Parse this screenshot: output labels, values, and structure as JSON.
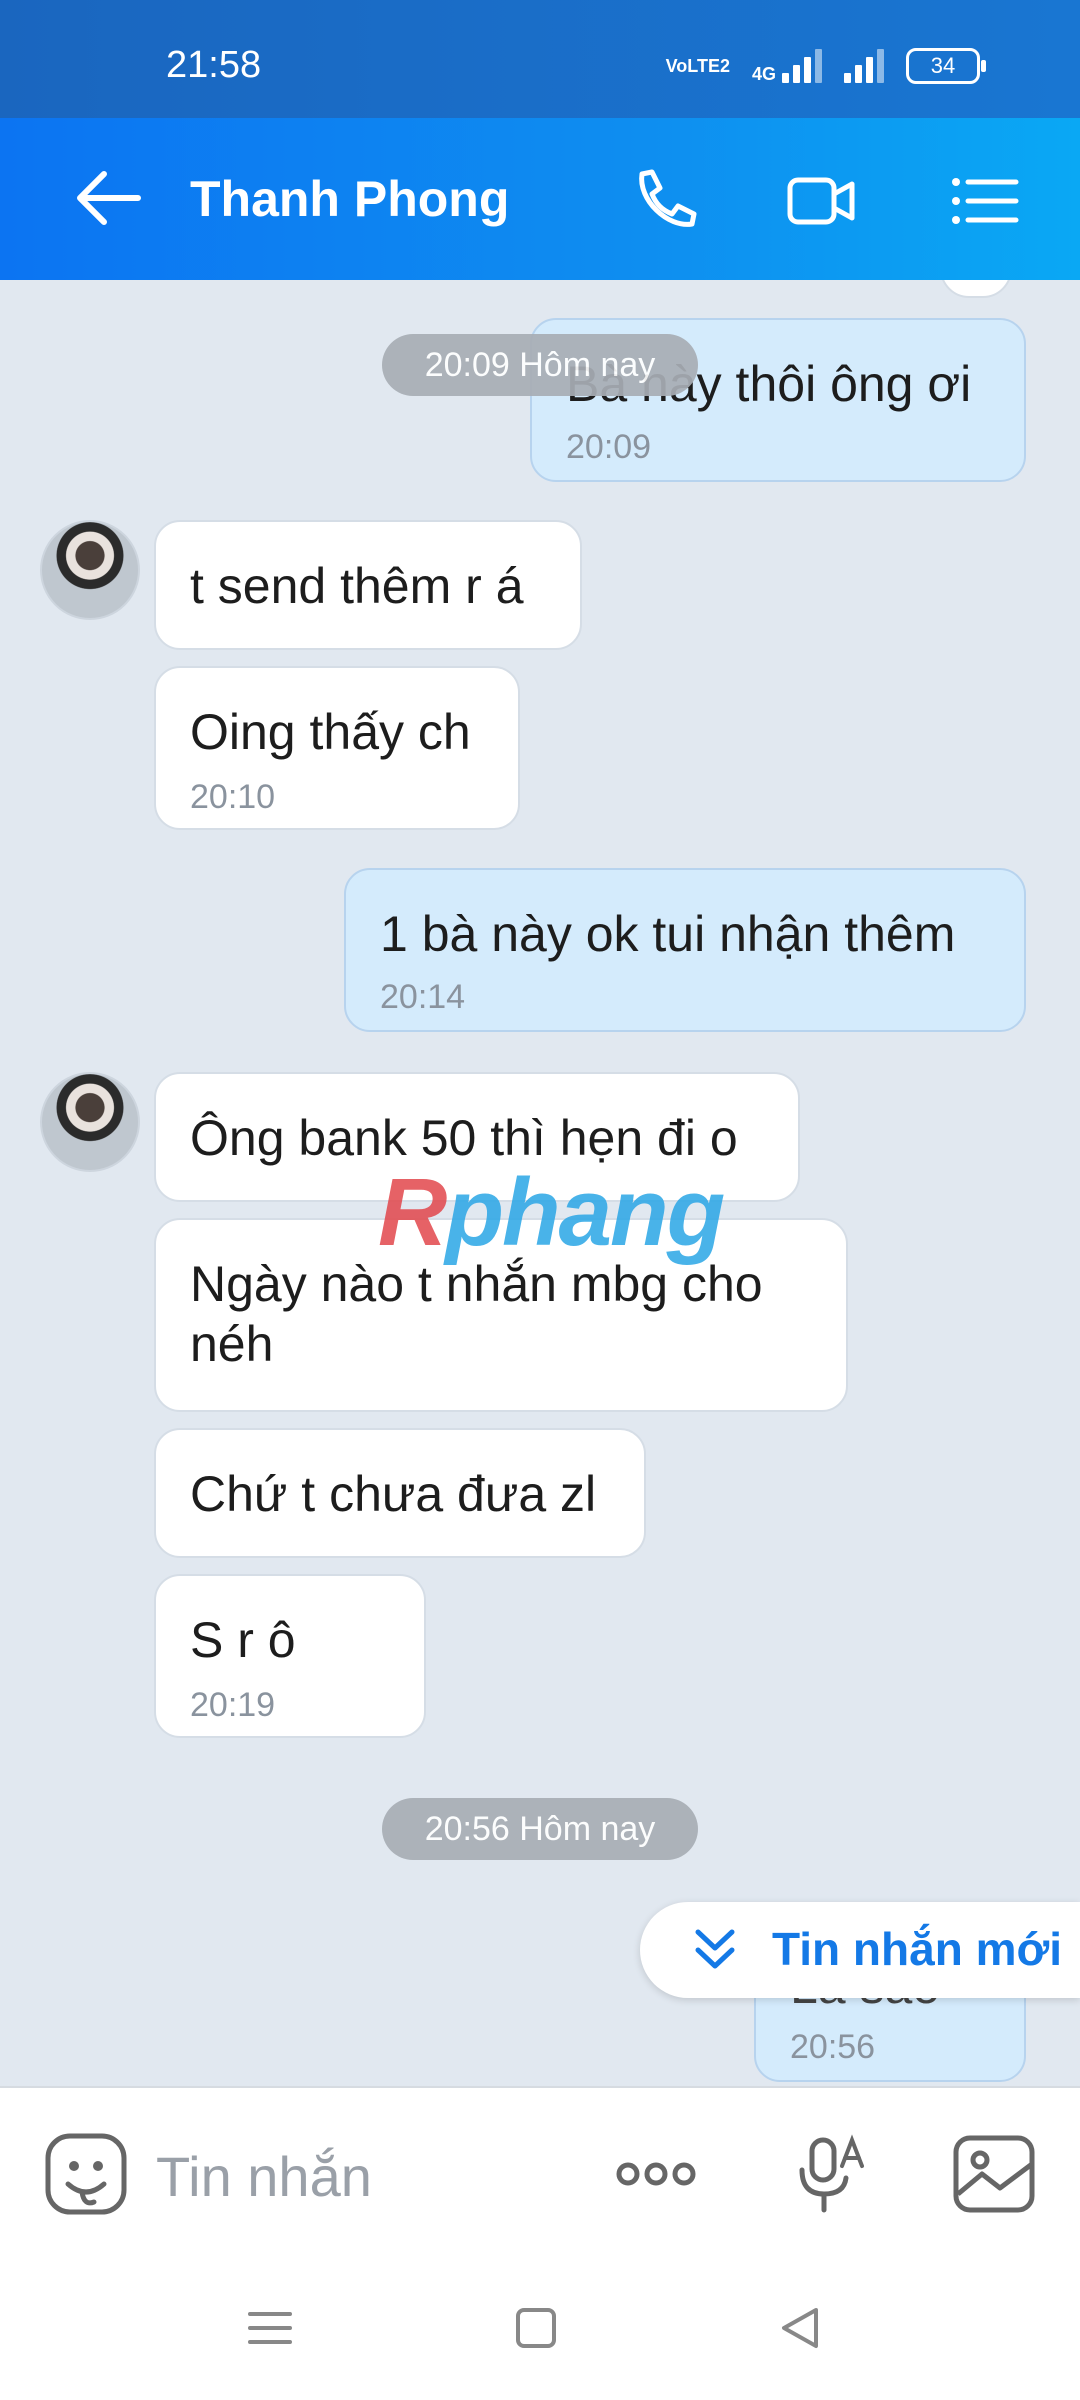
{
  "status_bar": {
    "time": "21:58",
    "network_label": "VoLTE2",
    "data_label": "4G",
    "battery": "34"
  },
  "header": {
    "contact_name": "Thanh Phong"
  },
  "messages": [
    {
      "text": "Bà này thôi ông ơi",
      "time": "20:09"
    },
    {
      "text": "t send thêm r á"
    },
    {
      "text": "Oing thấy ch",
      "time": "20:10"
    },
    {
      "text": "1 bà này ok tui nhận thêm",
      "time": "20:14"
    },
    {
      "text": "Ông bank 50 thì hẹn đi o"
    },
    {
      "text": "Ngày nào t nhắn mbg cho néh"
    },
    {
      "text": "Chứ t chưa đưa zl"
    },
    {
      "text": "S r ô",
      "time": "20:19"
    },
    {
      "text": "Là sao",
      "time": "20:56"
    }
  ],
  "date_pills": [
    "20:09 Hôm nay",
    "20:56 Hôm nay"
  ],
  "watermark": {
    "r": "R",
    "rest": "phang"
  },
  "new_messages_button": "Tin nhắn mới",
  "composer": {
    "placeholder": "Tin nhắn"
  },
  "colors": {
    "header": "#0c74f2",
    "outgoing_bubble": "#d4ebfc",
    "accent": "#1479e6"
  }
}
